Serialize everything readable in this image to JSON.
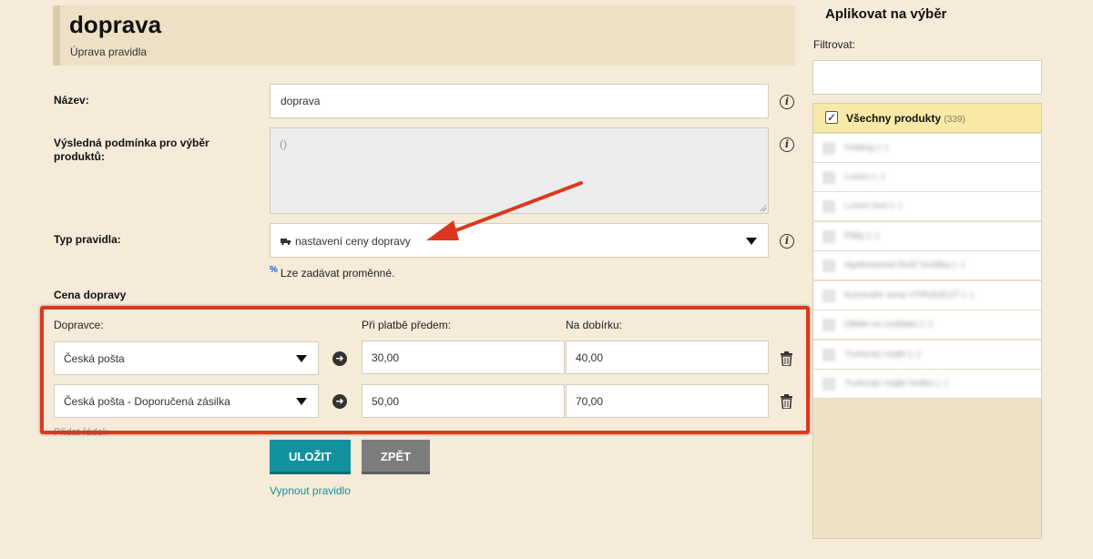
{
  "header": {
    "title": "doprava",
    "subtitle": "Úprava pravidla"
  },
  "form": {
    "name_label": "Název:",
    "name_value": "doprava",
    "condition_label": "Výsledná podmínka pro výběr produktů:",
    "condition_placeholder": "()",
    "type_label": "Typ pravidla:",
    "type_value": "nastavení ceny dopravy",
    "hint_symbol": "%",
    "hint_text": "Lze zadávat proměnné."
  },
  "shipping": {
    "section_title": "Cena dopravy",
    "col_carrier": "Dopravce:",
    "col_prepay": "Při platbě předem:",
    "col_cod": "Na dobírku:",
    "rows": [
      {
        "carrier": "Česká pošta",
        "prepay": "30,00",
        "cod": "40,00"
      },
      {
        "carrier": "Česká pošta - Doporučená zásilka",
        "prepay": "50,00",
        "cod": "70,00"
      }
    ],
    "add_row_label": "Přidat řádek"
  },
  "actions": {
    "save": "ULOŽIT",
    "back": "ZPĚT",
    "disable": "Vypnout pravidlo"
  },
  "right_panel": {
    "title": "Aplikovat na výběr",
    "filter_label": "Filtrovat:",
    "all_label": "Všechny produkty",
    "all_count": "(339)",
    "items": [
      "Hotdog (--)",
      "Lorem (--)",
      "Lorem text (--)",
      "Pláty (--)",
      "Agebrowned Rušť hrnštka (--)",
      "Komínáře sena VÝRODEUT (--)",
      "Oblek na rozkladu (--)",
      "Truheraú rosjbt (--)",
      "Truheraú rosjbt Hrdba (--)"
    ]
  },
  "colors": {
    "accent": "#12919e",
    "highlight": "#d93a1f",
    "background": "#f5ebd8"
  }
}
